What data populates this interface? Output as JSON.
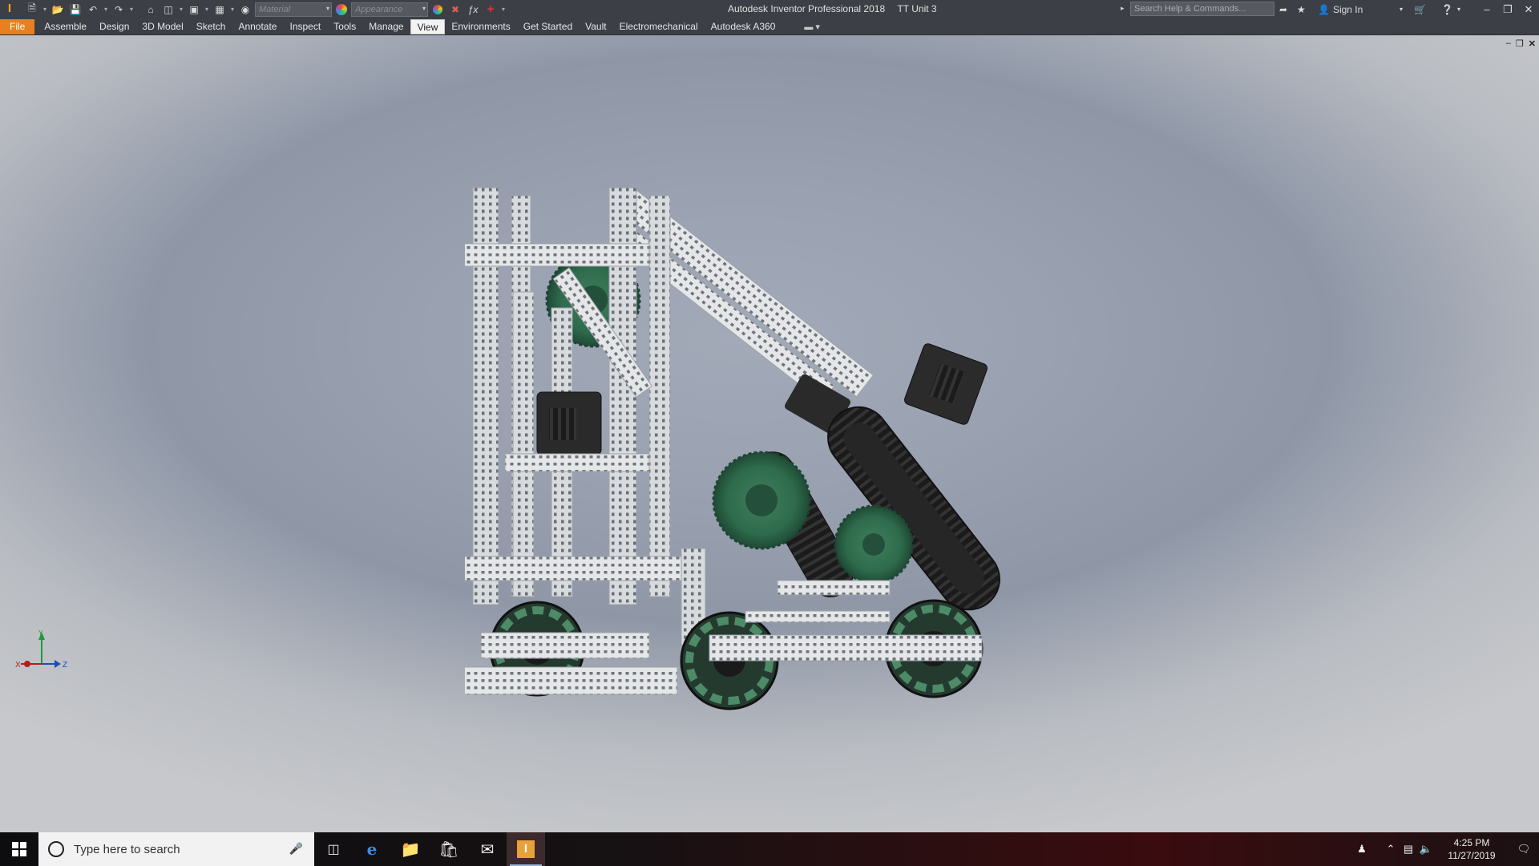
{
  "titlebar": {
    "app_name": "Autodesk Inventor Professional 2018",
    "document": "TT Unit 3",
    "material_placeholder": "Material",
    "appearance_placeholder": "Appearance",
    "search_placeholder": "Search Help & Commands...",
    "sign_in": "Sign In"
  },
  "ribbon": {
    "file": "File",
    "tabs": [
      "Assemble",
      "Design",
      "3D Model",
      "Sketch",
      "Annotate",
      "Inspect",
      "Tools",
      "Manage",
      "View",
      "Environments",
      "Get Started",
      "Vault",
      "Electromechanical",
      "Autodesk A360"
    ],
    "active_tab": "View"
  },
  "viewcube": {
    "x_label": "X",
    "y_label": "Y",
    "z_label": "Z"
  },
  "taskbar": {
    "search_placeholder": "Type here to search",
    "time": "4:25 PM",
    "date": "11/27/2019"
  },
  "colors": {
    "file_tab": "#e8801f",
    "chrome": "#3c3f45",
    "rail": "#e4e6e8",
    "gear_green": "#2e6b4c",
    "motor": "#2a2a2a"
  },
  "icons": [
    "new-icon",
    "open-icon",
    "save-icon",
    "undo-icon",
    "redo-icon",
    "home-icon",
    "update-icon",
    "select-icon",
    "appearance-icon",
    "clear-override-icon",
    "fx-icon",
    "add-icon",
    "search-icon",
    "exchange-icon",
    "star-icon",
    "user-icon",
    "cart-icon",
    "help-icon",
    "windows-icon",
    "mic-icon",
    "task-view-icon",
    "edge-icon",
    "explorer-icon",
    "store-icon",
    "mail-icon",
    "inventor-icon",
    "people-icon",
    "chevron-up-icon",
    "network-icon",
    "volume-icon",
    "notification-icon"
  ]
}
